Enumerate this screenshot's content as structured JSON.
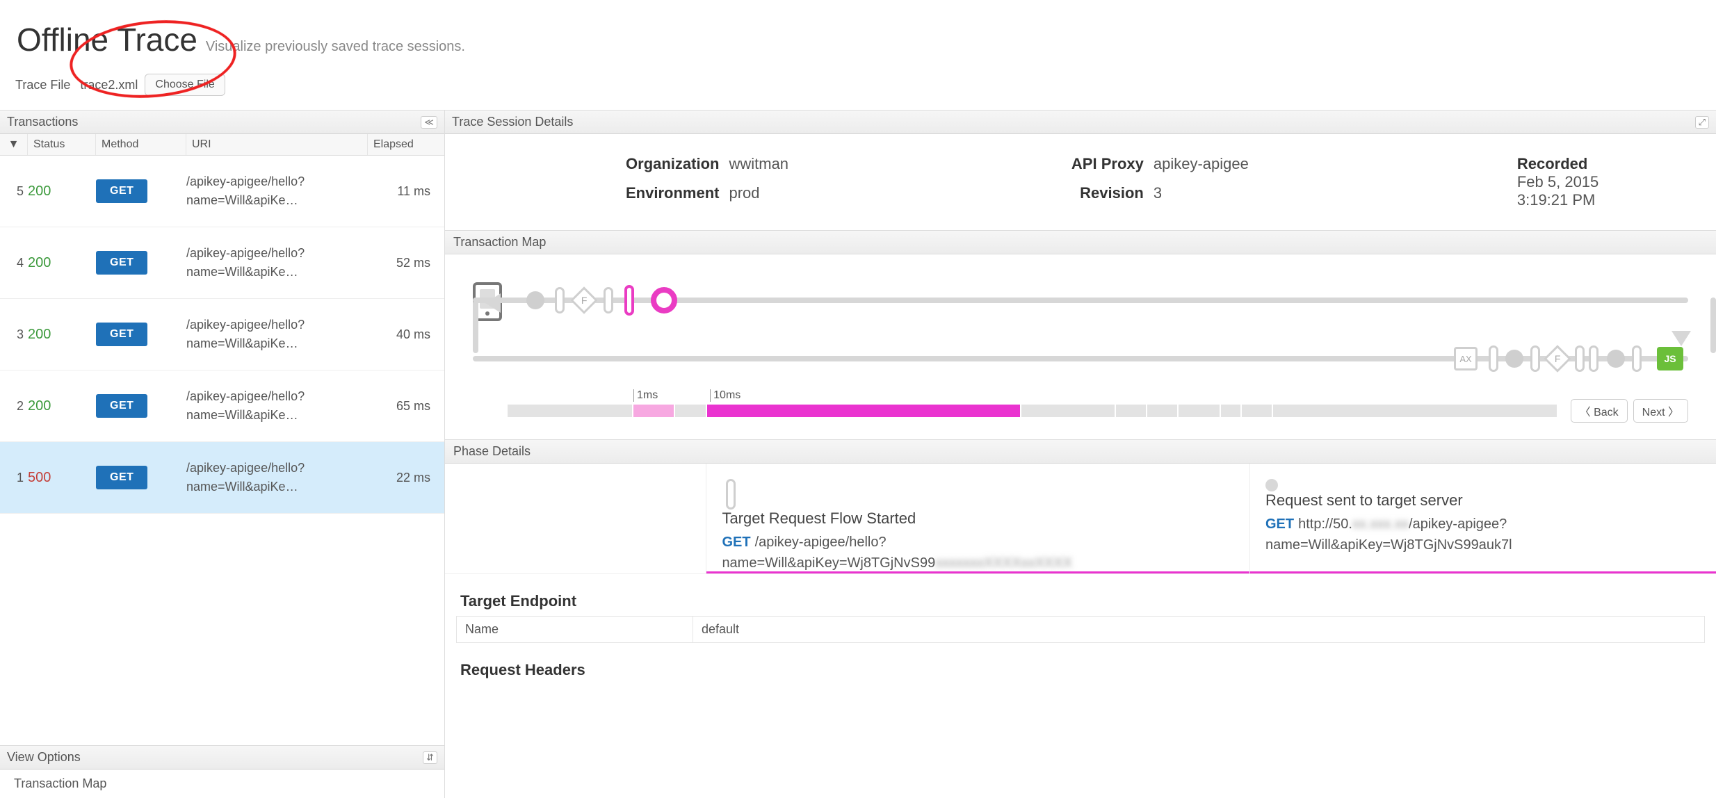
{
  "header": {
    "title": "Offline Trace",
    "subtitle": "Visualize previously saved trace sessions."
  },
  "traceFile": {
    "label": "Trace File",
    "filename": "trace2.xml",
    "chooseBtn": "Choose File"
  },
  "leftPanel": {
    "transactionsTitle": "Transactions",
    "collapseGlyph": "≪",
    "cols": {
      "caret": "▼",
      "status": "Status",
      "method": "Method",
      "uri": "URI",
      "elapsed": "Elapsed"
    },
    "rows": [
      {
        "idx": "5",
        "status": "200",
        "statusClass": "status-200",
        "method": "GET",
        "uri": "/apikey-apigee/hello?name=Will&apiKe…",
        "elapsed": "11 ms",
        "selected": false
      },
      {
        "idx": "4",
        "status": "200",
        "statusClass": "status-200",
        "method": "GET",
        "uri": "/apikey-apigee/hello?name=Will&apiKe…",
        "elapsed": "52 ms",
        "selected": false
      },
      {
        "idx": "3",
        "status": "200",
        "statusClass": "status-200",
        "method": "GET",
        "uri": "/apikey-apigee/hello?name=Will&apiKe…",
        "elapsed": "40 ms",
        "selected": false
      },
      {
        "idx": "2",
        "status": "200",
        "statusClass": "status-200",
        "method": "GET",
        "uri": "/apikey-apigee/hello?name=Will&apiKe…",
        "elapsed": "65 ms",
        "selected": false
      },
      {
        "idx": "1",
        "status": "500",
        "statusClass": "status-500",
        "method": "GET",
        "uri": "/apikey-apigee/hello?name=Will&apiKe…",
        "elapsed": "22 ms",
        "selected": true
      }
    ],
    "viewOptions": {
      "title": "View Options",
      "expandGlyph": "⇵",
      "item1": "Transaction Map"
    }
  },
  "rightPanel": {
    "detailsTitle": "Trace Session Details",
    "expandGlyph": "⤢",
    "summary": {
      "orgLabel": "Organization",
      "org": "wwitman",
      "envLabel": "Environment",
      "env": "prod",
      "proxyLabel": "API Proxy",
      "proxy": "apikey-apigee",
      "revLabel": "Revision",
      "rev": "3",
      "recordedLabel": "Recorded",
      "recordedDate": "Feb 5, 2015",
      "recordedTime": "3:19:21 PM"
    },
    "txMapTitle": "Transaction Map",
    "timing": {
      "label1": "1ms",
      "label2": "10ms",
      "backBtn": "Back",
      "nextBtn": "Next"
    },
    "phaseTitle": "Phase Details",
    "phaseLeft": {
      "title": "Target Request Flow Started",
      "get": "GET",
      "uri": "/apikey-apigee/hello?name=Will&apiKey=Wj8TGjNvS99"
    },
    "phaseRight": {
      "title": "Request sent to target server",
      "get": "GET",
      "uriPrefix": "http://50.",
      "uriSuffix": "/apikey-apigee?name=Will&apiKey=Wj8TGjNvS99auk7l"
    },
    "targetEndpoint": {
      "heading": "Target Endpoint",
      "key": "Name",
      "val": "default"
    },
    "requestHeaders": {
      "heading": "Request Headers"
    }
  }
}
